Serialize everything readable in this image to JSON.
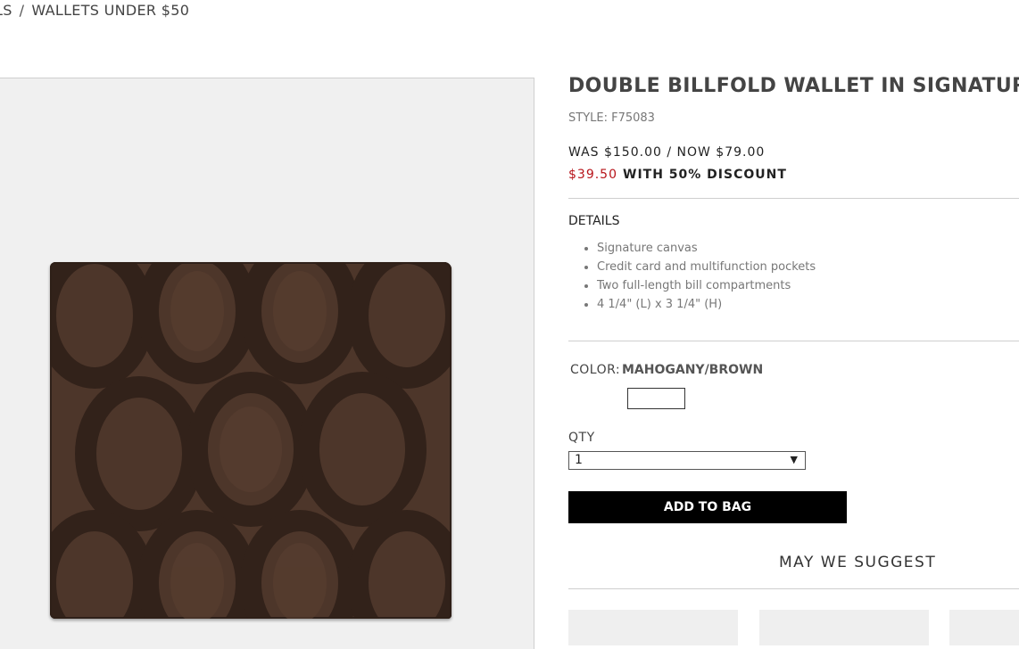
{
  "breadcrumb": {
    "previous": "LS",
    "separator": "/",
    "current": "WALLETS UNDER $50"
  },
  "product": {
    "title": "DOUBLE BILLFOLD WALLET IN SIGNATURE",
    "style": "STYLE: F75083",
    "price": "WAS $150.00 / NOW $79.00",
    "discount_price": "$39.50",
    "discount_text": "WITH 50% DISCOUNT",
    "image_alt": "Mahogany/Brown signature double billfold wallet"
  },
  "details": {
    "title": "DETAILS",
    "items": [
      "Signature canvas",
      "Credit card and multifunction pockets",
      "Two full-length bill compartments",
      "4 1/4\" (L) x 3 1/4\" (H)"
    ]
  },
  "color": {
    "label": "COLOR:",
    "value": "MAHOGANY/BROWN"
  },
  "qty": {
    "label": "QTY",
    "selected": "1",
    "arrow": "▼"
  },
  "actions": {
    "add_to_bag": "ADD TO BAG"
  },
  "suggest": {
    "title": "MAY WE SUGGEST"
  },
  "colors": {
    "accent": "#b7141a",
    "button_bg": "#000000",
    "wallet": "#4d362a"
  }
}
